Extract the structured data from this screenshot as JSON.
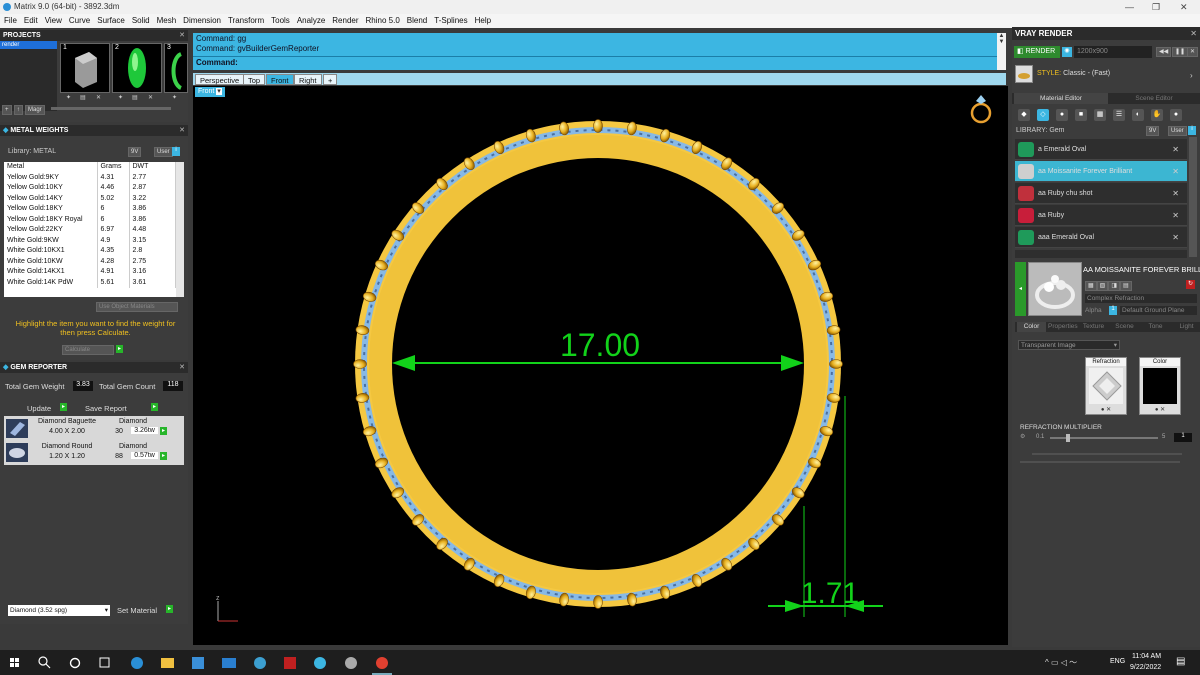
{
  "window": {
    "title": "Matrix 9.0 (64-bit) - 3892.3dm",
    "min": "—",
    "max": "❐",
    "close": "✕"
  },
  "menu": [
    "File",
    "Edit",
    "View",
    "Curve",
    "Surface",
    "Solid",
    "Mesh",
    "Dimension",
    "Transform",
    "Tools",
    "Analyze",
    "Render",
    "Rhino 5.0",
    "Blend",
    "T-Splines",
    "Help"
  ],
  "projects": {
    "title": "PROJECTS",
    "item": "render",
    "thumbs": [
      "1",
      "2",
      "3"
    ],
    "magic": "Magr"
  },
  "metal": {
    "title": "METAL WEIGHTS",
    "library": "Library: METAL",
    "library_btn": "9V",
    "user_btn": "User",
    "headers": [
      "Metal",
      "Grams",
      "DWT"
    ],
    "rows": [
      [
        "Yellow Gold:9KY",
        "4.31",
        "2.77"
      ],
      [
        "Yellow Gold:10KY",
        "4.46",
        "2.87"
      ],
      [
        "Yellow Gold:14KY",
        "5.02",
        "3.22"
      ],
      [
        "Yellow Gold:18KY",
        "6",
        "3.86"
      ],
      [
        "Yellow Gold:18KY Royal",
        "6",
        "3.86"
      ],
      [
        "Yellow Gold:22KY",
        "6.97",
        "4.48"
      ],
      [
        "White Gold:9KW",
        "4.9",
        "3.15"
      ],
      [
        "White Gold:10KX1",
        "4.35",
        "2.8"
      ],
      [
        "White Gold:10KW",
        "4.28",
        "2.75"
      ],
      [
        "White Gold:14KX1",
        "4.91",
        "3.16"
      ],
      [
        "White Gold:14K PdW",
        "5.61",
        "3.61"
      ]
    ],
    "use_obj": "Use Object Materials",
    "hint": "Highlight the item you want to find the weight for then press Calculate.",
    "calculate": "Calculate"
  },
  "gem": {
    "title": "GEM REPORTER",
    "total_weight_label": "Total Gem Weight",
    "total_weight": "3.83",
    "total_count_label": "Total Gem Count",
    "total_count": "118",
    "update": "Update",
    "save": "Save Report",
    "items": [
      {
        "name": "Diamond Baguette",
        "mat": "Diamond",
        "size": "4.00 X 2.00",
        "count": "30",
        "ctw": "3.26tw"
      },
      {
        "name": "Diamond Round",
        "mat": "Diamond",
        "size": "1.20 X 1.20",
        "count": "88",
        "ctw": "0.57tw"
      }
    ],
    "material_select": "Diamond   (3.52 spg)",
    "set_material": "Set Material"
  },
  "command": {
    "line1": "Command: gg",
    "line2": "Command: gvBuilderGemReporter",
    "prompt": "Command:"
  },
  "view_tabs": [
    "Perspective",
    "Top",
    "Front",
    "Right",
    "+"
  ],
  "viewport": {
    "label": "Front",
    "dim_main": "17.00",
    "dim_small": "1.71",
    "axis_z": "z"
  },
  "vray": {
    "title": "VRAY RENDER",
    "render": "RENDER",
    "resolution": "1200x900",
    "style_label": "STYLE:",
    "style": "Classic - (Fast)",
    "tab_material": "Material Editor",
    "tab_scene": "Scene Editor",
    "library": "LIBRARY: Gem",
    "lib_btn": "9V",
    "user_btn": "User",
    "materials": [
      {
        "name": "a Emerald Oval",
        "color": "#1f9a5a"
      },
      {
        "name": "aa Moissanite Forever Brilliant",
        "color": "#cfcfcf"
      },
      {
        "name": "aa Ruby chu shot",
        "color": "#c0303c"
      },
      {
        "name": "aa Ruby",
        "color": "#c81e3a"
      },
      {
        "name": "aaa Emerald Oval",
        "color": "#1f9a5a"
      }
    ],
    "selected": "AA MOISSANITE FOREVER BRILLIANT",
    "shader": "Complex Refraction",
    "alpha": "Alpha",
    "ground": "Default Ground Plane",
    "sub_tabs": [
      "Color",
      "Properties",
      "Texture",
      "Scene",
      "Tone",
      "Light"
    ],
    "transparent": "Transparent Image",
    "refraction": "Refraction",
    "color": "Color",
    "refr_mult": "REFRACTION MULTIPLIER",
    "refr_min": "0.1",
    "refr_max": "5",
    "refr_val": "1"
  },
  "taskbar": {
    "lang": "ENG",
    "time": "11:04 AM",
    "date": "9/22/2022"
  },
  "colors": {
    "gold": "#f5c842",
    "dim": "#12d21a",
    "cmd": "#3cb6e2",
    "vray_sel": "#3cb6d2"
  }
}
